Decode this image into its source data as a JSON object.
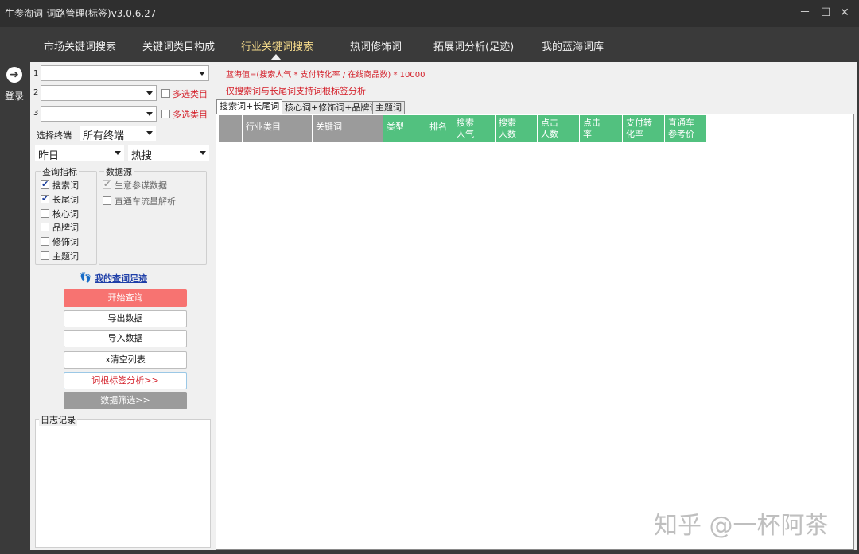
{
  "window": {
    "title": "生参淘词-词路管理(标签)v3.0.6.27",
    "min_icon": "－",
    "max_icon": "☐",
    "close_icon": "✕"
  },
  "nav": {
    "tabs": [
      "市场关键词搜索",
      "关键词类目构成",
      "行业关键词搜索",
      "热词修饰词",
      "拓展词分析(足迹)",
      "我的蓝海词库"
    ],
    "active": "行业关键词搜索"
  },
  "rail": {
    "login_label": "登录",
    "login_icon": "➜"
  },
  "filters": {
    "row1_num": "1",
    "row2_num": "2",
    "row3_num": "3",
    "row1_value": "",
    "row2_value": "",
    "row3_value": "",
    "multi_label_2": "多选类目",
    "multi_label_3": "多选类目",
    "terminal_label": "选择终端",
    "terminal_value": "所有终端",
    "date_value": "昨日",
    "sort_value": "热搜"
  },
  "metrics": {
    "legend": "查询指标",
    "items": [
      {
        "label": "搜索词",
        "checked": true
      },
      {
        "label": "长尾词",
        "checked": true
      },
      {
        "label": "核心词",
        "checked": false
      },
      {
        "label": "品牌词",
        "checked": false
      },
      {
        "label": "修饰词",
        "checked": false
      },
      {
        "label": "主题词",
        "checked": false
      }
    ]
  },
  "datasource": {
    "legend": "数据源",
    "items": [
      {
        "label": "生意参谋数据",
        "checked": true,
        "disabled": true
      },
      {
        "label": "直通车流量解析",
        "checked": false,
        "disabled": false
      }
    ]
  },
  "actions": {
    "history_icon": "👣",
    "history_link": "我的查词足迹",
    "start": "开始查询",
    "export": "导出数据",
    "import": "导入数据",
    "clear": "x清空列表",
    "tag_analysis": "词根标签分析>>",
    "filter": "数据筛选>>"
  },
  "log": {
    "legend": "日志记录"
  },
  "main": {
    "formula": "蓝海值=(搜索人气 * 支付转化率 / 在线商品数) * 10000",
    "note": "仅搜索词与长尾词支持词根标签分析",
    "subtabs": [
      "搜索词+长尾词",
      "核心词+修饰词+品牌词",
      "主题词"
    ],
    "active_subtab": "搜索词+长尾词",
    "columns": [
      "",
      "行业类目",
      "关键词",
      "类型",
      "排名",
      "搜索\n人气",
      "搜索\n人数",
      "点击\n人数",
      "点击\n率",
      "支付转\n化率",
      "直通车\n参考价"
    ]
  },
  "watermark": "知乎 @一杯阿茶",
  "colors": {
    "primary_button": "#f77371",
    "table_header_green": "#52c17f",
    "table_header_gray": "#9b9b9b",
    "accent_red": "#d4202a",
    "active_tab": "#f3d98a"
  }
}
